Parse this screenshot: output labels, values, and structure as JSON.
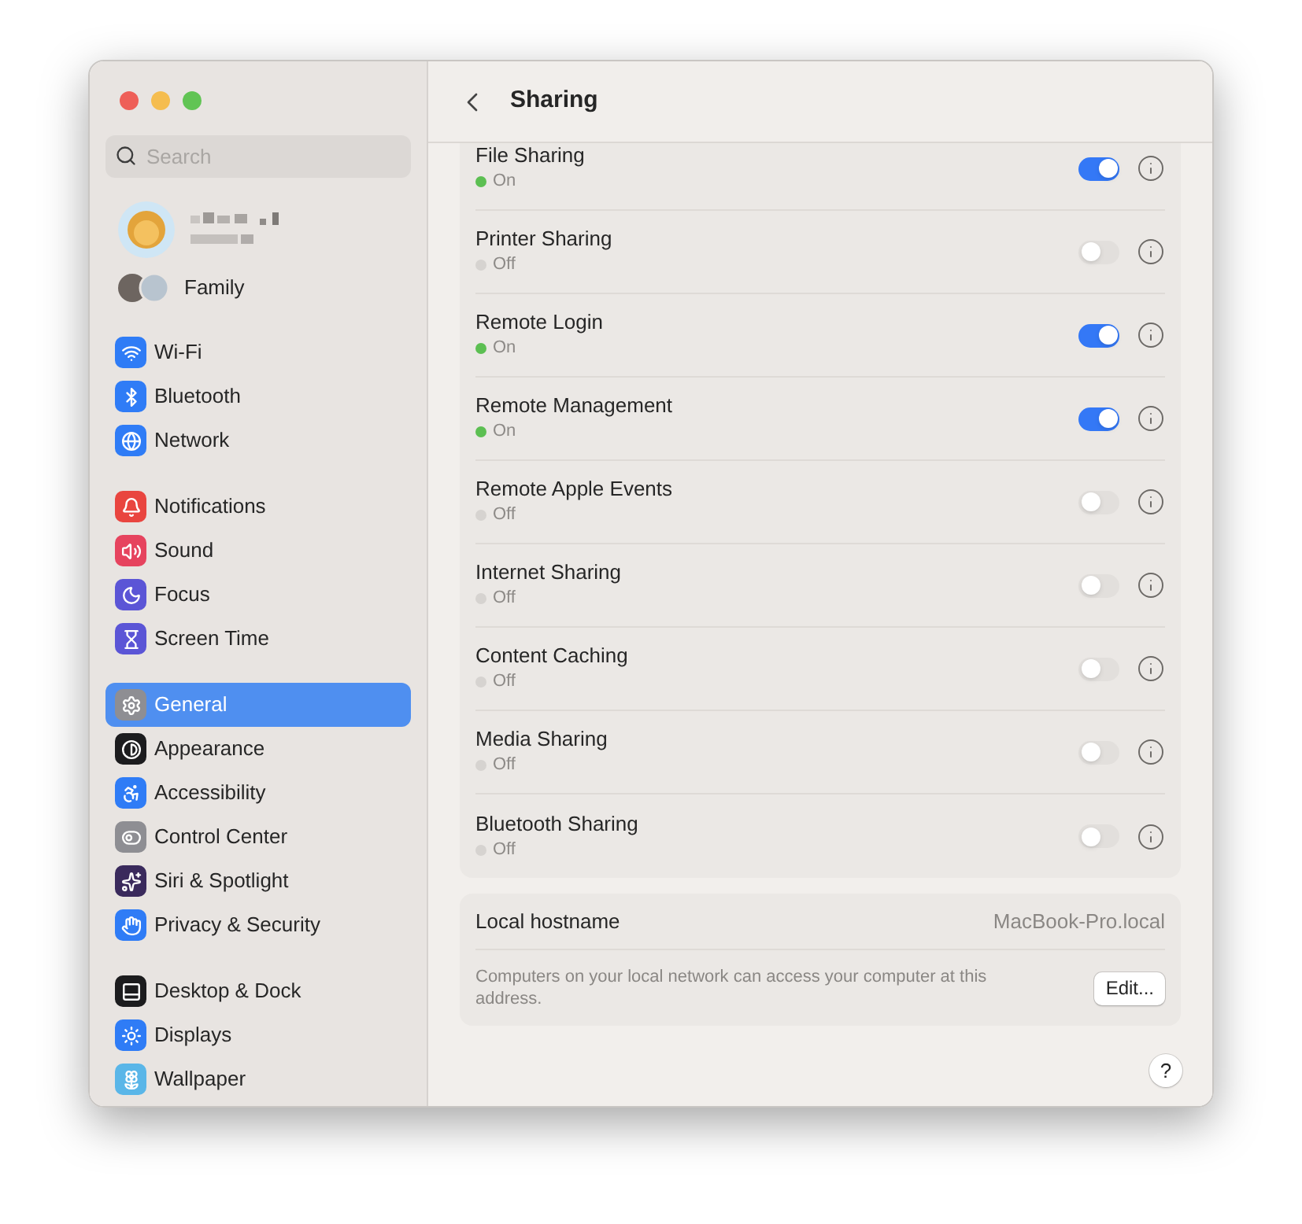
{
  "sidebar": {
    "search": {
      "placeholder": "Search"
    },
    "family": {
      "label": "Family"
    },
    "groups": [
      {
        "items": [
          {
            "label": "Wi-Fi",
            "selected": false
          },
          {
            "label": "Bluetooth",
            "selected": false
          },
          {
            "label": "Network",
            "selected": false
          }
        ]
      },
      {
        "items": [
          {
            "label": "Notifications",
            "selected": false
          },
          {
            "label": "Sound",
            "selected": false
          },
          {
            "label": "Focus",
            "selected": false
          },
          {
            "label": "Screen Time",
            "selected": false
          }
        ]
      },
      {
        "items": [
          {
            "label": "General",
            "selected": true
          },
          {
            "label": "Appearance",
            "selected": false
          },
          {
            "label": "Accessibility",
            "selected": false
          },
          {
            "label": "Control Center",
            "selected": false
          },
          {
            "label": "Siri & Spotlight",
            "selected": false
          },
          {
            "label": "Privacy & Security",
            "selected": false
          }
        ]
      },
      {
        "items": [
          {
            "label": "Desktop & Dock",
            "selected": false
          },
          {
            "label": "Displays",
            "selected": false
          },
          {
            "label": "Wallpaper",
            "selected": false
          }
        ]
      }
    ]
  },
  "header": {
    "title": "Sharing"
  },
  "services": [
    {
      "name": "File Sharing",
      "status": "On",
      "on": true
    },
    {
      "name": "Printer Sharing",
      "status": "Off",
      "on": false
    },
    {
      "name": "Remote Login",
      "status": "On",
      "on": true
    },
    {
      "name": "Remote Management",
      "status": "On",
      "on": true
    },
    {
      "name": "Remote Apple Events",
      "status": "Off",
      "on": false
    },
    {
      "name": "Internet Sharing",
      "status": "Off",
      "on": false
    },
    {
      "name": "Content Caching",
      "status": "Off",
      "on": false
    },
    {
      "name": "Media Sharing",
      "status": "Off",
      "on": false
    },
    {
      "name": "Bluetooth Sharing",
      "status": "Off",
      "on": false
    }
  ],
  "hostname": {
    "label": "Local hostname",
    "value": "MacBook-Pro.local",
    "description": "Computers on your local network can access your computer at this address.",
    "button": "Edit..."
  },
  "help": "?"
}
